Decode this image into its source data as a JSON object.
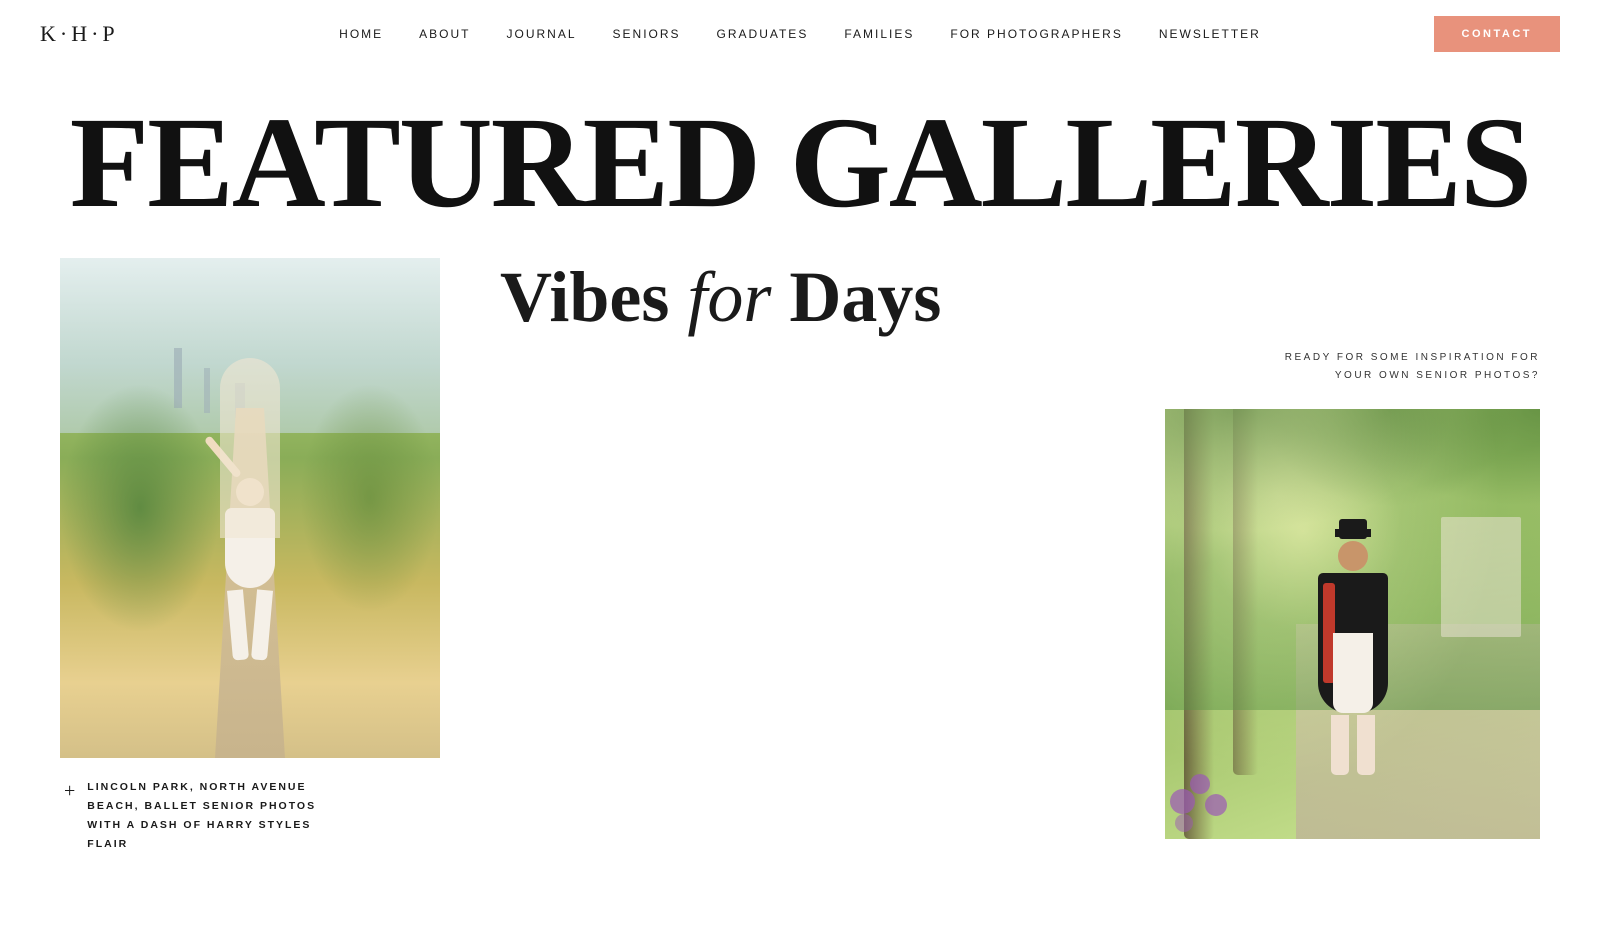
{
  "logo": {
    "text": "K·H·P"
  },
  "nav": {
    "links": [
      {
        "label": "HOME",
        "id": "home"
      },
      {
        "label": "ABOUT",
        "id": "about"
      },
      {
        "label": "JOURNAL",
        "id": "journal"
      },
      {
        "label": "SENIORS",
        "id": "seniors"
      },
      {
        "label": "GRADUATES",
        "id": "graduates"
      },
      {
        "label": "FAMILIES",
        "id": "families"
      },
      {
        "label": "FOR PHOTOGRAPHERS",
        "id": "for-photographers"
      },
      {
        "label": "NEWSLETTER",
        "id": "newsletter"
      }
    ],
    "contact_btn": "CONTACT"
  },
  "hero": {
    "title": "FEATURED GALLERIES"
  },
  "section": {
    "vibes_bold": "Vibes ",
    "vibes_italic": "for",
    "vibes_days": " Days",
    "subtitle_line1": "READY FOR SOME INSPIRATION FOR",
    "subtitle_line2": "YOUR OWN SENIOR PHOTOS?",
    "caption_icon": "+",
    "caption_text": "LINCOLN PARK, NORTH AVENUE\nBEACH, BALLET SENIOR PHOTOS\nWITH A DASH OF HARRY STYLES\nFLAIR"
  }
}
